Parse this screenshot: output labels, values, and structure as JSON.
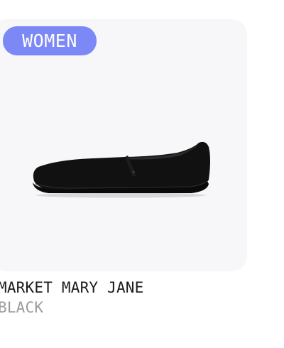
{
  "product": {
    "category_badge": "WOMEN",
    "name": "MARKET MARY JANE",
    "color": "BLACK",
    "image_icon": "mary-jane-shoe-image"
  },
  "colors": {
    "badge_background": "#7b88f6",
    "badge_text": "#ffffff",
    "card_background": "#f7f7f9",
    "name_text": "#1c1c1c",
    "color_text": "#9b9b9b",
    "shoe": "#111111"
  }
}
